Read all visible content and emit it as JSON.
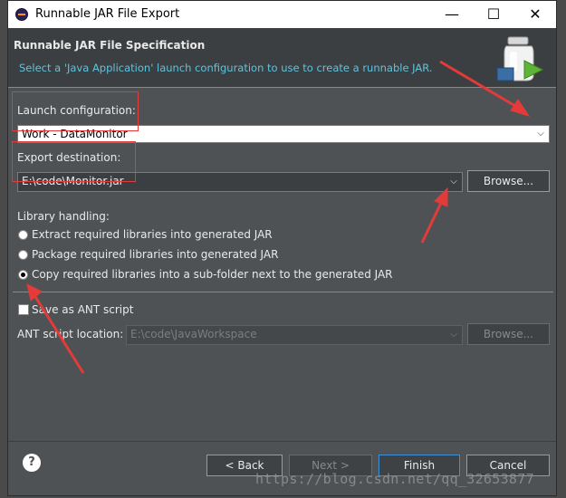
{
  "window": {
    "title": "Runnable JAR File Export",
    "minimize": "—",
    "maximize": "☐",
    "close": "✕"
  },
  "header": {
    "title": "Runnable JAR File Specification",
    "description": "Select a 'Java Application' launch configuration to use to create a runnable JAR."
  },
  "launch": {
    "label": "Launch configuration:",
    "value": "Work - DataMonitor"
  },
  "export": {
    "label": "Export destination:",
    "value": "E:\\code\\Monitor.jar",
    "browse": "Browse..."
  },
  "library": {
    "label": "Library handling:",
    "options": [
      {
        "label": "Extract required libraries into generated JAR",
        "checked": false
      },
      {
        "label": "Package required libraries into generated JAR",
        "checked": false
      },
      {
        "label": "Copy required libraries into a sub-folder next to the generated JAR",
        "checked": true
      }
    ]
  },
  "ant": {
    "save_label": "Save as ANT script",
    "location_label": "ANT script location:",
    "location_value": "E:\\code\\JavaWorkspace",
    "browse": "Browse..."
  },
  "footer": {
    "help": "?",
    "back": "< Back",
    "next": "Next >",
    "finish": "Finish",
    "cancel": "Cancel"
  },
  "watermark": "https://blog.csdn.net/qq_32653877",
  "colors": {
    "accent_text": "#5ec4de",
    "annotation": "#e33a3a",
    "background": "#4f5254"
  }
}
